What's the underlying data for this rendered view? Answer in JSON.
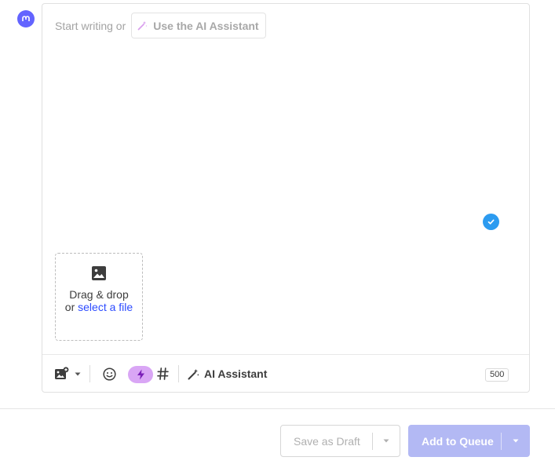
{
  "composer": {
    "prompt_text": "Start writing or",
    "ai_chip_label": "Use the AI Assistant",
    "avatar_icon": "mastodon-icon"
  },
  "dropzone": {
    "line1": "Drag & drop",
    "or": "or",
    "link": "select a file"
  },
  "toolbar": {
    "ai_assistant_label": "AI Assistant",
    "char_count": "500",
    "icons": [
      "image-add-icon",
      "chevron-down-icon",
      "emoji-icon",
      "bolt-icon",
      "hashtag-icon",
      "magic-wand-icon"
    ]
  },
  "footer": {
    "save_draft_label": "Save as Draft",
    "add_queue_label": "Add to Queue"
  },
  "colors": {
    "accent": "#b3b9f4",
    "check": "#2c9bf0",
    "link": "#2c4bff",
    "bolt_pill": "#d9a6f5",
    "avatar": "#6364ff"
  }
}
